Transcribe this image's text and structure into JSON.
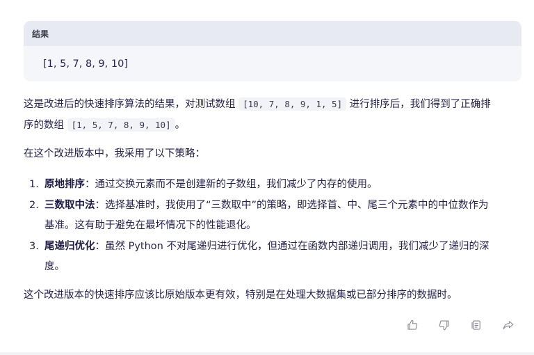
{
  "result_card": {
    "header": "结果",
    "value": "[1, 5, 7, 8, 9, 10]"
  },
  "paragraph1": {
    "pre": "这是改进后的快速排序算法的结果，对测试数组 ",
    "code1": "[10, 7, 8, 9, 1, 5]",
    "mid": " 进行排序后，我们得到了正确排",
    "mid2": "序的数组 ",
    "code2": "[1, 5, 7, 8, 9, 10]",
    "post": "。"
  },
  "paragraph2": "在这个改进版本中，我采用了以下策略：",
  "strategies": [
    {
      "num": "1.",
      "title": "原地排序",
      "text": "：通过交换元素而不是创建新的子数组，我们减少了内存的使用。"
    },
    {
      "num": "2.",
      "title": "三数取中法",
      "text": "：选择基准时，我使用了“三数取中”的策略，即选择首、中、尾三个元素中的中位数作为",
      "text2": "基准。这有助于避免在最坏情况下的性能退化。"
    },
    {
      "num": "3.",
      "title": "尾递归优化",
      "text": "：虽然 Python 不对尾递归进行优化，但通过在函数内部递归调用，我们减少了递归的深",
      "text2": "度。"
    }
  ],
  "paragraph3": "这个改进版本的快速排序应该比原始版本更有效，特别是在处理大数据集或已部分排序的数据时。",
  "actions": [
    "thumbs-up-icon",
    "thumbs-down-icon",
    "copy-icon",
    "share-icon"
  ]
}
